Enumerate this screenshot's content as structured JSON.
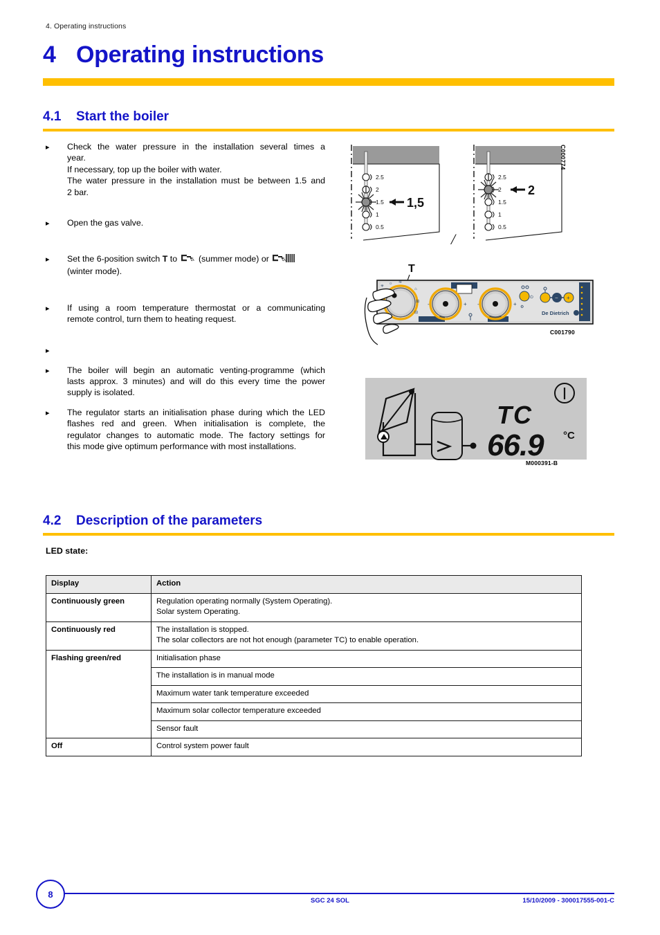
{
  "running_header": "4. Operating instructions",
  "chapter": {
    "number": "4",
    "title": "Operating instructions"
  },
  "sections": [
    {
      "number": "4.1",
      "title": "Start the boiler"
    },
    {
      "number": "4.2",
      "title": "Description of the parameters"
    }
  ],
  "bullets": [
    {
      "mark": "▸",
      "lines": [
        "Check the water pressure in the installation several times a",
        "year.",
        "If necessary, top up the boiler with water.",
        "The water pressure in the installation must be between 1.5 and",
        "2 bar."
      ]
    },
    {
      "mark": "▸",
      "lines": [
        "Open the gas valve."
      ]
    },
    {
      "mark": "▸",
      "segments": {
        "pre": "Set the 6-position switch ",
        "bold_t": "T",
        "mid1": " to ",
        "icon1": "tap-icon",
        "mid2": " (summer mode) or ",
        "icon2": "tap-radiator-icon",
        "post": "(winter mode)."
      }
    },
    {
      "mark": "▸",
      "lines": [
        "If using a room temperature thermostat or a communicating",
        "remote control, turn them to heating request."
      ]
    },
    {
      "mark": "▸",
      "lines": [
        ""
      ]
    },
    {
      "mark": "▸",
      "lines": [
        "The boiler will begin an automatic venting-programme (which",
        "lasts approx. 3 minutes) and will do this every time the power",
        "supply is isolated."
      ]
    },
    {
      "mark": "▸",
      "lines": [
        "The regulator starts an initialisation phase during which the LED",
        "flashes red and green. When initialisation is complete, the",
        "regulator changes to automatic mode. The factory settings for",
        "this mode give optimum performance with most installations."
      ]
    }
  ],
  "figures": {
    "pressure_gauge": {
      "code": "C000774",
      "scale_labels": [
        "2.5",
        "2",
        "1.5",
        "1",
        "0.5"
      ],
      "left_callout": "1,5",
      "right_callout": "2",
      "separator": "/",
      "left_active_index": 2,
      "right_active_index": 1
    },
    "control_panel": {
      "code": "C001790",
      "callout": "T",
      "brand": "De Dietrich"
    },
    "lcd_display": {
      "code": "M000391-B",
      "parameter": "TC",
      "value": "66.9",
      "unit": "°C",
      "power_symbol": "I",
      "background": "#c8c8c8"
    }
  },
  "led_state": {
    "label": "LED state:",
    "headers": [
      "Display",
      "Action"
    ],
    "rows": [
      {
        "display": "Continuously green",
        "actions": [
          "Regulation operating normally (System Operating).",
          "Solar system Operating."
        ]
      },
      {
        "display": "Continuously red",
        "actions": [
          "The installation is stopped.",
          "The solar collectors are not hot enough (parameter TC) to enable operation."
        ]
      },
      {
        "display": "Flashing green/red",
        "actions_split": [
          "Initialisation phase",
          "The installation is in manual mode",
          "Maximum water tank temperature exceeded",
          "Maximum solar collector temperature exceeded",
          "Sensor fault"
        ]
      },
      {
        "display": "Off",
        "actions": [
          "Control system power fault"
        ]
      }
    ]
  },
  "footer": {
    "page": "8",
    "center": "SGC 24 SOL",
    "right": "15/10/2009 - 300017555-001-C"
  },
  "colors": {
    "heading_blue": "#1414c8",
    "accent_gold": "#ffbf00",
    "table_header_bg": "#eaeaea",
    "panel_gray": "#c8c8c8"
  }
}
